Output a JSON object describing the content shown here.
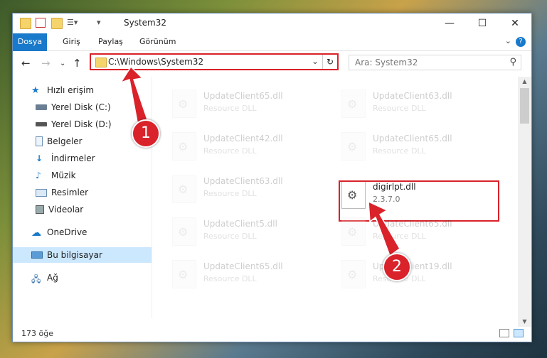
{
  "window": {
    "title": "System32",
    "controls": {
      "minimize": "—",
      "maximize": "☐",
      "close": "✕"
    }
  },
  "ribbon": {
    "tabs": [
      {
        "label": "Dosya"
      },
      {
        "label": "Giriş"
      },
      {
        "label": "Paylaş"
      },
      {
        "label": "Görünüm"
      }
    ],
    "help": "?"
  },
  "nav": {
    "address": "C:\\Windows\\System32",
    "search_placeholder": "Ara: System32"
  },
  "sidebar": {
    "items": [
      {
        "label": "Hızlı erişim",
        "icon": "star-icon"
      },
      {
        "label": "Yerel Disk (C:)",
        "icon": "drive-icon"
      },
      {
        "label": "Yerel Disk (D:)",
        "icon": "drive-icon"
      },
      {
        "label": "Belgeler",
        "icon": "documents-icon"
      },
      {
        "label": "İndirmeler",
        "icon": "download-icon"
      },
      {
        "label": "Müzik",
        "icon": "music-icon"
      },
      {
        "label": "Resimler",
        "icon": "pictures-icon"
      },
      {
        "label": "Videolar",
        "icon": "video-icon"
      },
      {
        "label": "OneDrive",
        "icon": "cloud-icon"
      },
      {
        "label": "Bu bilgisayar",
        "icon": "computer-icon"
      },
      {
        "label": "Ağ",
        "icon": "network-icon"
      }
    ]
  },
  "files": [
    {
      "name": "UpdateClient65.dll",
      "type": "Resource DLL"
    },
    {
      "name": "UpdateClient63.dll",
      "type": "Resource DLL"
    },
    {
      "name": "UpdateClient42.dll",
      "type": "Resource DLL"
    },
    {
      "name": "UpdateClient65.dll",
      "type": "Resource DLL"
    },
    {
      "name": "UpdateClient63.dll",
      "type": "Resource DLL"
    },
    {
      "name": "digirlpt.dll",
      "type": "2.3.7.0"
    },
    {
      "name": "UpdateClient5.dll",
      "type": "Resource DLL"
    },
    {
      "name": "UpdateClient65.dll",
      "type": "Resource DLL"
    },
    {
      "name": "UpdateClient65.dll",
      "type": "Resource DLL"
    },
    {
      "name": "UpdateClient19.dll",
      "type": "Resource DLL"
    }
  ],
  "status": {
    "count": "173 öğe"
  },
  "callouts": {
    "one": "1",
    "two": "2"
  },
  "colors": {
    "accent": "#1979ca",
    "highlight": "#d9222a",
    "selected": "#cce8ff"
  }
}
